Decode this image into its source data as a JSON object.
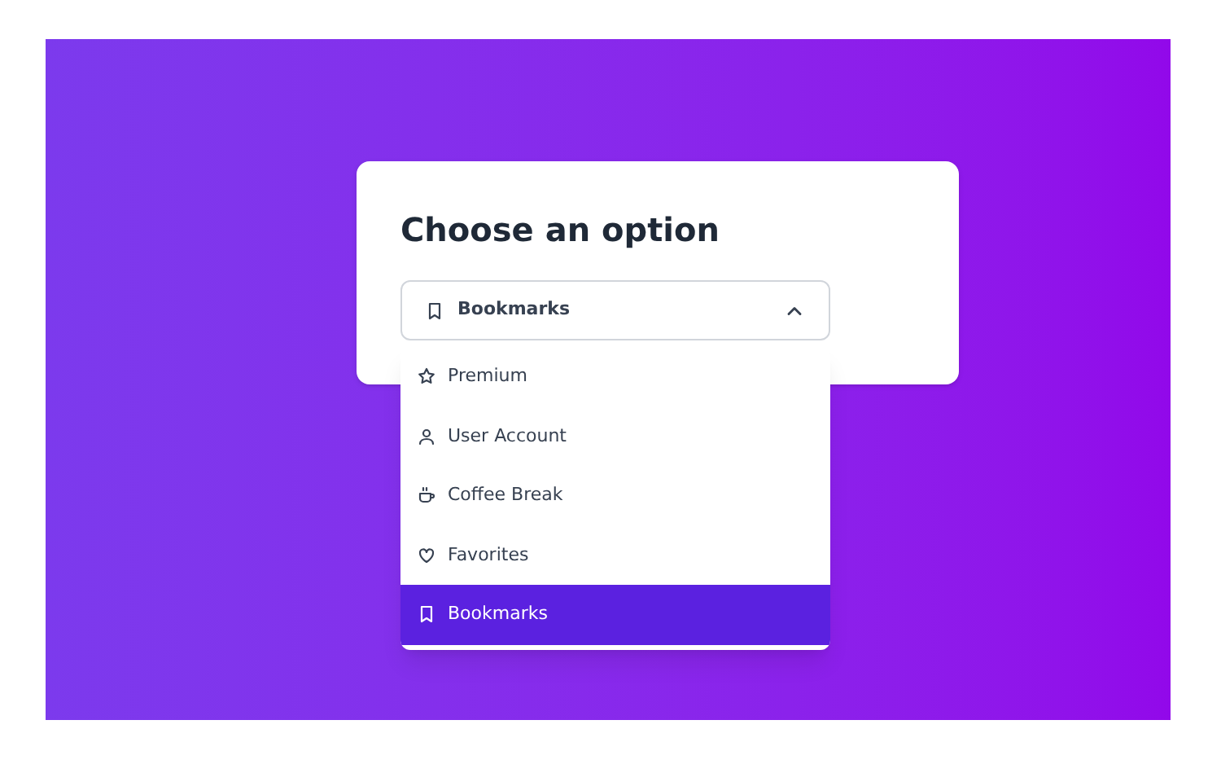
{
  "title": "Choose an option",
  "select": {
    "value": "Bookmarks",
    "kind": "bookmark",
    "expanded": true
  },
  "options": [
    {
      "label": "Premium",
      "kind": "star",
      "selected": false
    },
    {
      "label": "User Account",
      "kind": "user",
      "selected": false
    },
    {
      "label": "Coffee Break",
      "kind": "cup",
      "selected": false
    },
    {
      "label": "Favorites",
      "kind": "heart",
      "selected": false
    },
    {
      "label": "Bookmarks",
      "kind": "bookmark",
      "selected": true
    }
  ]
}
